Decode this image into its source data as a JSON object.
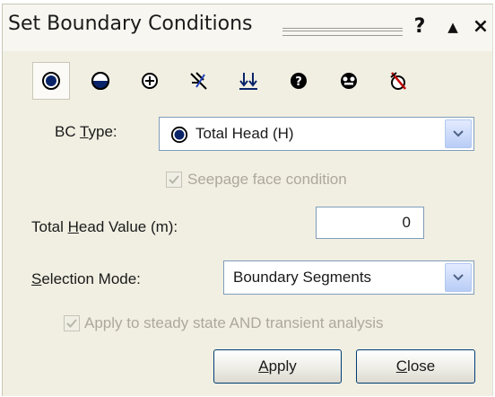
{
  "window": {
    "title": "Set Boundary Conditions",
    "help_label": "?",
    "collapse_label": "▲",
    "close_label": "×"
  },
  "toolbar": {
    "icons": [
      {
        "name": "total-head-icon",
        "selected": true
      },
      {
        "name": "pressure-head-icon",
        "selected": false
      },
      {
        "name": "flux-icon",
        "selected": false
      },
      {
        "name": "infiltration-icon",
        "selected": false
      },
      {
        "name": "unit-flux-icon",
        "selected": false
      },
      {
        "name": "unknown-icon",
        "selected": false
      },
      {
        "name": "seepage-icon",
        "selected": false
      },
      {
        "name": "remove-bc-icon",
        "selected": false
      }
    ]
  },
  "bc_type": {
    "label_pre": "BC ",
    "label_ul": "T",
    "label_post": "ype:",
    "value": "Total Head (H)"
  },
  "seepage": {
    "label": "Seepage face condition",
    "checked": true,
    "enabled": false
  },
  "total_head": {
    "label_pre": "Total ",
    "label_ul": "H",
    "label_post": "ead Value (m):",
    "value": "0"
  },
  "selection_mode": {
    "label_ul": "S",
    "label_post": "election Mode:",
    "value": "Boundary Segments"
  },
  "apply_transient": {
    "label": "Apply to steady state AND transient analysis",
    "checked": true,
    "enabled": false
  },
  "buttons": {
    "apply_ul": "A",
    "apply_post": "pply",
    "close_ul": "C",
    "close_post": "lose"
  },
  "colors": {
    "panel_bg": "#f1efe2",
    "accent_blue": "#0a246a",
    "disabled_text": "#ada99a"
  }
}
